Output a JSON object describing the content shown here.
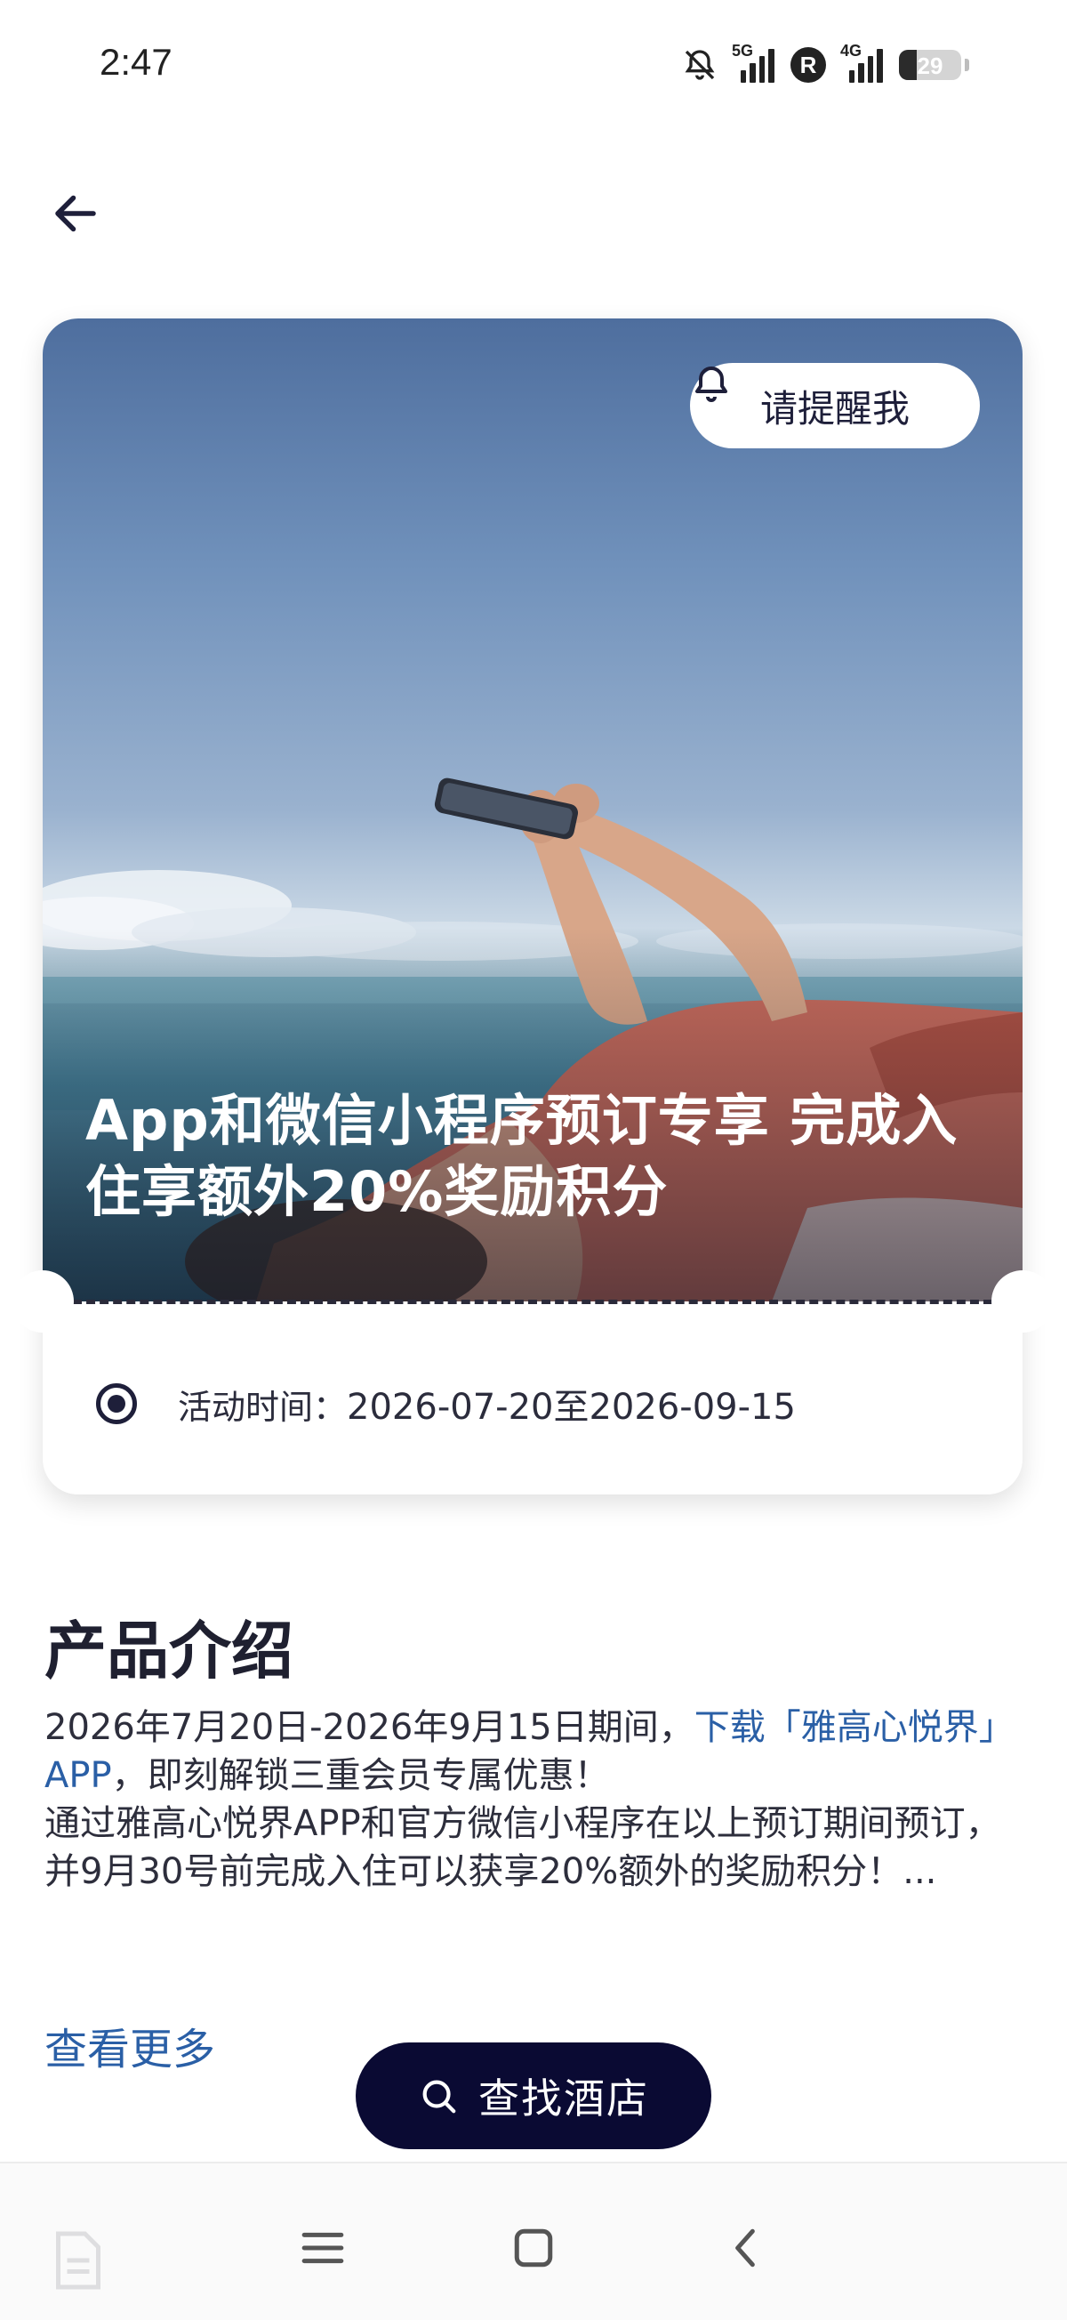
{
  "status_bar": {
    "time": "2:47",
    "network_1": "5G",
    "network_2": "4G",
    "roaming_badge": "R",
    "battery_level": 29,
    "battery_text": "29",
    "icons": [
      "bell-muted-icon",
      "signal-5g-icon",
      "roaming-icon",
      "signal-4g-icon",
      "battery-icon"
    ]
  },
  "header": {
    "back_icon": "arrow-left-icon"
  },
  "hero": {
    "remind_label": "请提醒我",
    "remind_icon": "bell-icon",
    "title": "App和微信小程序预订专享 完成入住享额外20%奖励积分",
    "period_label": "活动时间：",
    "period_value": "2026-07-20至2026-09-15"
  },
  "intro": {
    "heading": "产品介绍",
    "text_1": "2026年7月20日-2026年9月15日期间，",
    "link": "下载「雅高心悦界」APP",
    "text_2": "，即刻解锁三重会员专属优惠！",
    "text_3": "通过雅高心悦界APP和官方微信小程序在以上预订期间预订，并9月30号前完成入住可以获享20%额外的奖励积分！...",
    "see_more": "查看更多"
  },
  "find_hotel": {
    "label": "查找酒店",
    "icon": "search-icon"
  },
  "nav_bar": {
    "icons": [
      "menu-icon",
      "home-square-icon",
      "back-chevron-icon"
    ]
  },
  "colors": {
    "accent_dark": "#0a0a33",
    "link_blue": "#2a5fa6",
    "text_dark": "#1f2030"
  }
}
